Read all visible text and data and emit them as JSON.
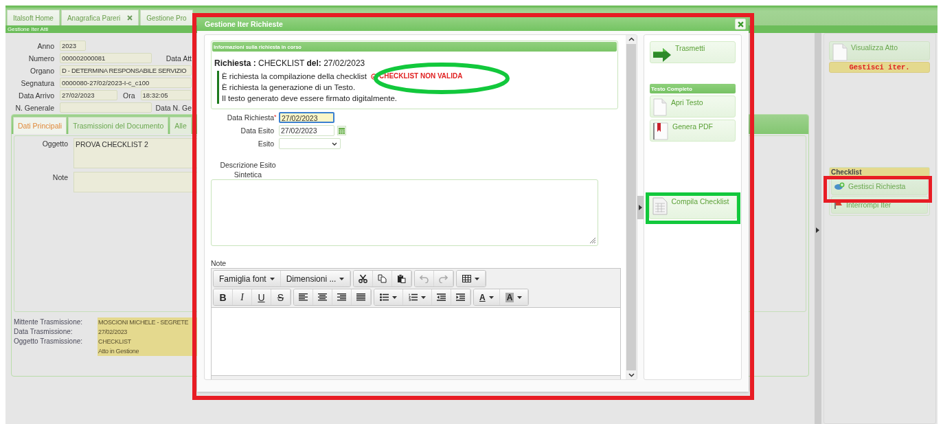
{
  "app_tabs": [
    {
      "label": "Italsoft Home",
      "closable": false
    },
    {
      "label": "Anagrafica Pareri",
      "closable": true
    },
    {
      "label": "Gestione Pro",
      "closable": false
    }
  ],
  "breadcrumb": "Gestione Iter Atti",
  "record_fields": [
    {
      "label": "Anno",
      "value": "2023"
    },
    {
      "label": "Numero",
      "value": "000002000081",
      "side_label": "Data Att"
    },
    {
      "label": "Organo",
      "value": "D - DETERMINA RESPONSABILE SERVIZIO"
    },
    {
      "label": "Segnatura",
      "value": "0000080-27/02/2023-I-c_c100"
    },
    {
      "label": "Data Arrivo",
      "value": "27/02/2023",
      "extra_label": "Ora",
      "extra_value": "18:32:05"
    },
    {
      "label": "N. Generale",
      "side_label": "Data N. Ge"
    }
  ],
  "doc_tabs": [
    {
      "label": "Dati Principali",
      "selected": true
    },
    {
      "label": "Trasmissioni del Documento",
      "selected": false
    },
    {
      "label": "Alle",
      "selected": false
    }
  ],
  "doc_fields": [
    {
      "label": "Oggetto",
      "value": "PROVA CHECKLIST 2"
    },
    {
      "label": "Note"
    }
  ],
  "transmission": [
    {
      "label": "Mittente Trasmissione:",
      "value": "MOSCIONI MICHELE - SEGRETE"
    },
    {
      "label": "Data Trasmissione:",
      "value": "27/02/2023"
    },
    {
      "label": "Oggetto Trasmissione:",
      "value": "CHECKLIST"
    },
    {
      "value": "Atto in Gestione"
    }
  ],
  "side_panel": {
    "view_button": "Visualizza Atto",
    "status_badge": "Gestisci iter.",
    "section_title": "Checklist",
    "actions": [
      {
        "label": "Gestisci Richiesta",
        "kind": "manage"
      },
      {
        "label": "Interrompi Iter",
        "kind": "stop"
      }
    ]
  },
  "dialog": {
    "title": "Gestione Iter Richieste",
    "info_header": "Informazioni sulla richiesta in corso",
    "request_line": "**Richiesta :** CHECKLIST **del:** 27/02/2023",
    "requirements": [
      {
        "text": "È richiesta la compilazione della checklist",
        "status": "CHECKLIST NON VALIDA"
      },
      {
        "text": "È richiesta la generazione di un Testo."
      },
      {
        "text": "Il testo generato deve essere firmato digitalmente."
      }
    ],
    "form": [
      {
        "label": "Data Richiesta",
        "value": "27/02/2023",
        "required": true,
        "kind": "date",
        "focused": true
      },
      {
        "label": "Data Esito",
        "value": "27/02/2023",
        "required": false,
        "kind": "datepicker",
        "focused": false
      },
      {
        "label": "Esito",
        "required": false,
        "kind": "select",
        "focused": false
      }
    ],
    "required_marker": "*",
    "description_label": "Descrizione Esito Sintetica",
    "notes_label": "Note",
    "editor": {
      "font_family": "Famiglia font",
      "font_size": "Dimensioni ...",
      "history_enabled": false,
      "format_glyphs": [
        "B",
        "I",
        "U",
        "S"
      ],
      "color_glyphs": [
        "A",
        "A"
      ]
    },
    "actions": [
      {
        "label": "Trasmetti",
        "kind": "send"
      },
      {
        "label": "Testo Completo",
        "kind": "section"
      },
      {
        "label": "Apri Testo",
        "kind": "open"
      },
      {
        "label": "Genera PDF",
        "kind": "pdf"
      },
      {
        "label": "Compila Checklist",
        "kind": "checklist"
      }
    ]
  }
}
